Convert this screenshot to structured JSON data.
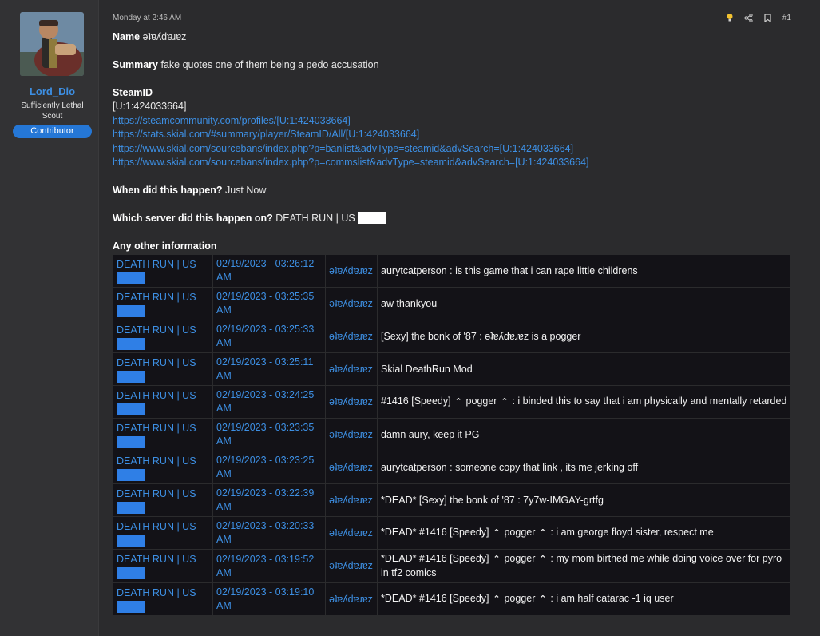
{
  "user": {
    "name": "Lord_Dio",
    "title_line1": "Sufficiently Lethal",
    "title_line2": "Scout",
    "badge": "Contributor"
  },
  "post": {
    "date": "Monday at 2:46 AM",
    "number": "#1",
    "icons": [
      "lightbulb-icon",
      "share-icon",
      "bookmark-icon"
    ],
    "name_label": "Name",
    "name_value": "ǝʇɐʎdɐɹɐz",
    "summary_label": "Summary",
    "summary_value": "fake quotes one of them being a pedo accusation",
    "steamid_label": "SteamID",
    "steamid_value": "[U:1:424033664]",
    "links": [
      "https://steamcommunity.com/profiles/[U:1:424033664]",
      "https://stats.skial.com/#summary/player/SteamID/All/[U:1:424033664]",
      "https://www.skial.com/sourcebans/index.php?p=banlist&advType=steamid&advSearch=[U:1:424033664]",
      "https://www.skial.com/sourcebans/index.php?p=commslist&advType=steamid&advSearch=[U:1:424033664]"
    ],
    "when_label": "When did this happen?",
    "when_value": "Just Now",
    "server_label": "Which server did this happen on?",
    "server_value": "DEATH RUN | US",
    "other_label": "Any other information"
  },
  "log": [
    {
      "server": "DEATH RUN | US",
      "time1": "02/19/2023 - 03:26:12",
      "time2": "AM",
      "player": "ǝʇɐʎdɐɹɐz",
      "message": "aurytcatperson : is this game that i can rape little childrens"
    },
    {
      "server": "DEATH RUN | US",
      "time1": "02/19/2023 - 03:25:35",
      "time2": "AM",
      "player": "ǝʇɐʎdɐɹɐz",
      "message": "aw thankyou"
    },
    {
      "server": "DEATH RUN | US",
      "time1": "02/19/2023 - 03:25:33",
      "time2": "AM",
      "player": "ǝʇɐʎdɐɹɐz",
      "message": "[Sexy] the bonk of '87 : ǝʇɐʎdɐɹɐz is a pogger"
    },
    {
      "server": "DEATH RUN | US",
      "time1": "02/19/2023 - 03:25:11",
      "time2": "AM",
      "player": "ǝʇɐʎdɐɹɐz",
      "message": "Skial DeathRun Mod"
    },
    {
      "server": "DEATH RUN | US",
      "time1": "02/19/2023 - 03:24:25",
      "time2": "AM",
      "player": "ǝʇɐʎdɐɹɐz",
      "msg_a": "#1416 [Speedy]",
      "msg_b": "pogger",
      "msg_c": ": i binded this to say that i am physically and mentally retarded"
    },
    {
      "server": "DEATH RUN | US",
      "time1": "02/19/2023 - 03:23:35",
      "time2": "AM",
      "player": "ǝʇɐʎdɐɹɐz",
      "message": "damn aury, keep it PG"
    },
    {
      "server": "DEATH RUN | US",
      "time1": "02/19/2023 - 03:23:25",
      "time2": "AM",
      "player": "ǝʇɐʎdɐɹɐz",
      "message": "aurytcatperson : someone copy that link , its me jerking off"
    },
    {
      "server": "DEATH RUN | US",
      "time1": "02/19/2023 - 03:22:39",
      "time2": "AM",
      "player": "ǝʇɐʎdɐɹɐz",
      "message": "*DEAD* [Sexy] the bonk of '87 : 7y7w-IMGAY-grtfg"
    },
    {
      "server": "DEATH RUN | US",
      "time1": "02/19/2023 - 03:20:33",
      "time2": "AM",
      "player": "ǝʇɐʎdɐɹɐz",
      "msg_a": "*DEAD* #1416 [Speedy]",
      "msg_b": "pogger",
      "msg_c": ": i am george floyd sister, respect me"
    },
    {
      "server": "DEATH RUN | US",
      "time1": "02/19/2023 - 03:19:52",
      "time2": "AM",
      "player": "ǝʇɐʎdɐɹɐz",
      "msg_a": "*DEAD* #1416 [Speedy]",
      "msg_b": "pogger",
      "msg_c": ": my mom birthed me while doing voice over for pyro in tf2 comics"
    },
    {
      "server": "DEATH RUN | US",
      "time1": "02/19/2023 - 03:19:10",
      "time2": "AM",
      "player": "ǝʇɐʎdɐɹɐz",
      "msg_a": "*DEAD* #1416 [Speedy]",
      "msg_b": "pogger",
      "msg_c": ": i am half catarac -1 iq user"
    }
  ],
  "colors": {
    "accent": "#3d8fe3",
    "badge": "#2577d6",
    "table_bg": "#131217"
  }
}
